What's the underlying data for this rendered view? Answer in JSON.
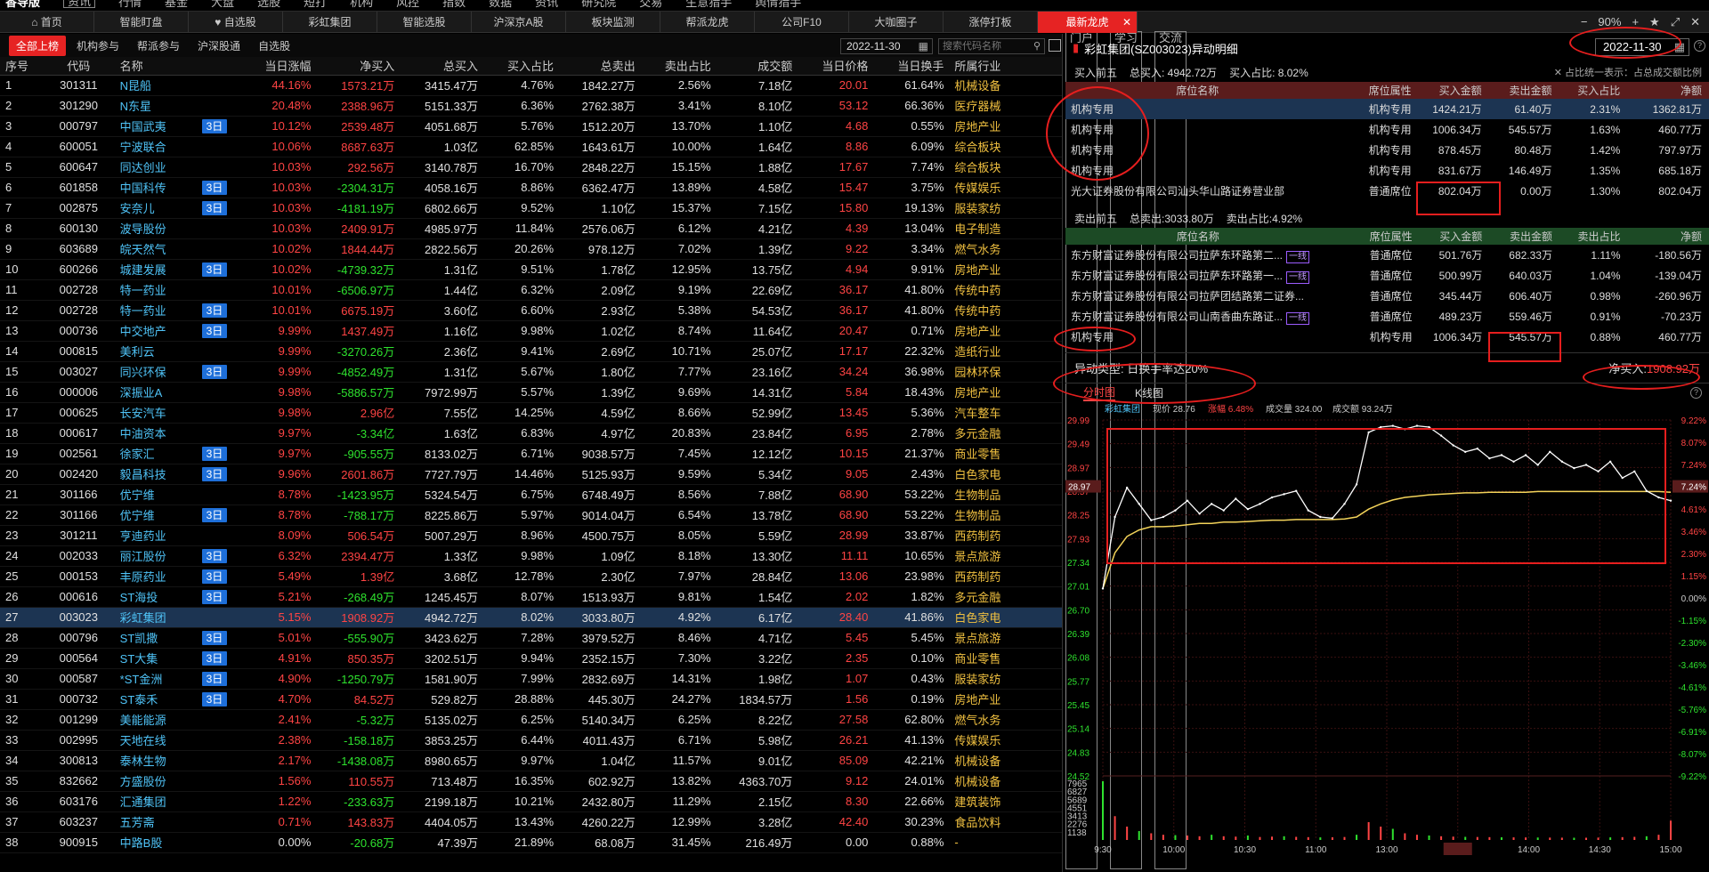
{
  "menubar": {
    "logo": "香导版",
    "logo_badge": "资讯",
    "items": [
      "行情",
      "基金",
      "大盘",
      "选股",
      "短打",
      "机构",
      "风控",
      "指数",
      "数据",
      "资讯",
      "研究院",
      "交易",
      "生意猎手",
      "舆情猎手"
    ],
    "right": [
      "门户",
      "学习",
      "交流"
    ]
  },
  "tabs": [
    "首页",
    "智能盯盘",
    "自选股",
    "彩虹集团",
    "智能选股",
    "沪深京A股",
    "板块监测",
    "帮派龙虎",
    "公司F10",
    "大咖圈子",
    "涨停打板",
    "最新龙虎"
  ],
  "zoom": "90%",
  "left": {
    "subtabs": [
      "全部上榜",
      "机构参与",
      "帮派参与",
      "沪深股通",
      "自选股"
    ],
    "date": "2022-11-30",
    "search_placeholder": "搜索代码名称",
    "columns": [
      "序号",
      "代码",
      "名称",
      "",
      "当日涨幅",
      "净买入",
      "总买入",
      "买入占比",
      "总卖出",
      "卖出占比",
      "成交额",
      "当日价格",
      "当日换手",
      "所属行业"
    ],
    "rows": [
      [
        "1",
        "301311",
        "N昆船",
        "",
        "44.16%",
        "1573.21万",
        "3415.47万",
        "4.76%",
        "1842.27万",
        "2.56%",
        "7.18亿",
        "20.01",
        "61.64%",
        "机械设备"
      ],
      [
        "2",
        "301290",
        "N东星",
        "",
        "20.48%",
        "2388.96万",
        "5151.33万",
        "6.36%",
        "2762.38万",
        "3.41%",
        "8.10亿",
        "53.12",
        "66.36%",
        "医疗器械"
      ],
      [
        "3",
        "000797",
        "中国武夷",
        "3日",
        "10.12%",
        "2539.48万",
        "4051.68万",
        "5.76%",
        "1512.20万",
        "13.70%",
        "1.10亿",
        "4.68",
        "0.55%",
        "房地产业"
      ],
      [
        "4",
        "600051",
        "宁波联合",
        "",
        "10.06%",
        "8687.63万",
        "1.03亿",
        "62.85%",
        "1643.61万",
        "10.00%",
        "1.64亿",
        "8.86",
        "6.09%",
        "综合板块"
      ],
      [
        "5",
        "600647",
        "同达创业",
        "",
        "10.03%",
        "292.56万",
        "3140.78万",
        "16.70%",
        "2848.22万",
        "15.15%",
        "1.88亿",
        "17.67",
        "7.74%",
        "综合板块"
      ],
      [
        "6",
        "601858",
        "中国科传",
        "3日",
        "10.03%",
        "-2304.31万",
        "4058.16万",
        "8.86%",
        "6362.47万",
        "13.89%",
        "4.58亿",
        "15.47",
        "3.75%",
        "传媒娱乐"
      ],
      [
        "7",
        "002875",
        "安奈儿",
        "3日",
        "10.03%",
        "-4181.19万",
        "6802.66万",
        "9.52%",
        "1.10亿",
        "15.37%",
        "7.15亿",
        "15.80",
        "19.13%",
        "服装家纺"
      ],
      [
        "8",
        "600130",
        "波导股份",
        "",
        "10.03%",
        "2409.91万",
        "4985.97万",
        "11.84%",
        "2576.06万",
        "6.12%",
        "4.21亿",
        "4.39",
        "13.04%",
        "电子制造"
      ],
      [
        "9",
        "603689",
        "皖天然气",
        "",
        "10.02%",
        "1844.44万",
        "2822.56万",
        "20.26%",
        "978.12万",
        "7.02%",
        "1.39亿",
        "9.22",
        "3.34%",
        "燃气水务"
      ],
      [
        "10",
        "600266",
        "城建发展",
        "3日",
        "10.02%",
        "-4739.32万",
        "1.31亿",
        "9.51%",
        "1.78亿",
        "12.95%",
        "13.75亿",
        "4.94",
        "9.91%",
        "房地产业"
      ],
      [
        "11",
        "002728",
        "特一药业",
        "",
        "10.01%",
        "-6506.97万",
        "1.44亿",
        "6.32%",
        "2.09亿",
        "9.19%",
        "22.69亿",
        "36.17",
        "41.80%",
        "传统中药"
      ],
      [
        "12",
        "002728",
        "特一药业",
        "3日",
        "10.01%",
        "6675.19万",
        "3.60亿",
        "6.60%",
        "2.93亿",
        "5.38%",
        "54.53亿",
        "36.17",
        "41.80%",
        "传统中药"
      ],
      [
        "13",
        "000736",
        "中交地产",
        "3日",
        "9.99%",
        "1437.49万",
        "1.16亿",
        "9.98%",
        "1.02亿",
        "8.74%",
        "11.64亿",
        "20.47",
        "0.71%",
        "房地产业"
      ],
      [
        "14",
        "000815",
        "美利云",
        "",
        "9.99%",
        "-3270.26万",
        "2.36亿",
        "9.41%",
        "2.69亿",
        "10.71%",
        "25.07亿",
        "17.17",
        "22.32%",
        "造纸行业"
      ],
      [
        "15",
        "003027",
        "同兴环保",
        "3日",
        "9.99%",
        "-4852.49万",
        "1.31亿",
        "5.67%",
        "1.80亿",
        "7.77%",
        "23.16亿",
        "34.24",
        "36.98%",
        "园林环保"
      ],
      [
        "16",
        "000006",
        "深振业A",
        "",
        "9.98%",
        "-5886.57万",
        "7972.99万",
        "5.57%",
        "1.39亿",
        "9.69%",
        "14.31亿",
        "5.84",
        "18.43%",
        "房地产业"
      ],
      [
        "17",
        "000625",
        "长安汽车",
        "",
        "9.98%",
        "2.96亿",
        "7.55亿",
        "14.25%",
        "4.59亿",
        "8.66%",
        "52.99亿",
        "13.45",
        "5.36%",
        "汽车整车"
      ],
      [
        "18",
        "000617",
        "中油资本",
        "",
        "9.97%",
        "-3.34亿",
        "1.63亿",
        "6.83%",
        "4.97亿",
        "20.83%",
        "23.84亿",
        "6.95",
        "2.78%",
        "多元金融"
      ],
      [
        "19",
        "002561",
        "徐家汇",
        "3日",
        "9.97%",
        "-905.55万",
        "8133.02万",
        "6.71%",
        "9038.57万",
        "7.45%",
        "12.12亿",
        "10.15",
        "21.37%",
        "商业零售"
      ],
      [
        "20",
        "002420",
        "毅昌科技",
        "3日",
        "9.96%",
        "2601.86万",
        "7727.79万",
        "14.46%",
        "5125.93万",
        "9.59%",
        "5.34亿",
        "9.05",
        "2.43%",
        "白色家电"
      ],
      [
        "21",
        "301166",
        "优宁维",
        "",
        "8.78%",
        "-1423.95万",
        "5324.54万",
        "6.75%",
        "6748.49万",
        "8.56%",
        "7.88亿",
        "68.90",
        "53.22%",
        "生物制品"
      ],
      [
        "22",
        "301166",
        "优宁维",
        "3日",
        "8.78%",
        "-788.17万",
        "8225.86万",
        "5.97%",
        "9014.04万",
        "6.54%",
        "13.78亿",
        "68.90",
        "53.22%",
        "生物制品"
      ],
      [
        "23",
        "301211",
        "亨迪药业",
        "",
        "8.09%",
        "506.54万",
        "5007.29万",
        "8.96%",
        "4500.75万",
        "8.05%",
        "5.59亿",
        "28.99",
        "33.87%",
        "西药制药"
      ],
      [
        "24",
        "002033",
        "丽江股份",
        "3日",
        "6.32%",
        "2394.47万",
        "1.33亿",
        "9.98%",
        "1.09亿",
        "8.18%",
        "13.30亿",
        "11.11",
        "10.65%",
        "景点旅游"
      ],
      [
        "25",
        "000153",
        "丰原药业",
        "3日",
        "5.49%",
        "1.39亿",
        "3.68亿",
        "12.78%",
        "2.30亿",
        "7.97%",
        "28.84亿",
        "13.06",
        "23.98%",
        "西药制药"
      ],
      [
        "26",
        "000616",
        "ST海投",
        "3日",
        "5.21%",
        "-268.49万",
        "1245.45万",
        "8.07%",
        "1513.93万",
        "9.81%",
        "1.54亿",
        "2.02",
        "1.82%",
        "多元金融"
      ],
      [
        "27",
        "003023",
        "彩虹集团",
        "",
        "5.15%",
        "1908.92万",
        "4942.72万",
        "8.02%",
        "3033.80万",
        "4.92%",
        "6.17亿",
        "28.40",
        "41.86%",
        "白色家电"
      ],
      [
        "28",
        "000796",
        "ST凯撒",
        "3日",
        "5.01%",
        "-555.90万",
        "3423.62万",
        "7.28%",
        "3979.52万",
        "8.46%",
        "4.71亿",
        "5.45",
        "5.45%",
        "景点旅游"
      ],
      [
        "29",
        "000564",
        "ST大集",
        "3日",
        "4.91%",
        "850.35万",
        "3202.51万",
        "9.94%",
        "2352.15万",
        "7.30%",
        "3.22亿",
        "2.35",
        "0.10%",
        "商业零售"
      ],
      [
        "30",
        "000587",
        "*ST金洲",
        "3日",
        "4.90%",
        "-1250.79万",
        "1581.90万",
        "7.99%",
        "2832.69万",
        "14.31%",
        "1.98亿",
        "1.07",
        "0.43%",
        "服装家纺"
      ],
      [
        "31",
        "000732",
        "ST泰禾",
        "3日",
        "4.70%",
        "84.52万",
        "529.82万",
        "28.88%",
        "445.30万",
        "24.27%",
        "1834.57万",
        "1.56",
        "0.19%",
        "房地产业"
      ],
      [
        "32",
        "001299",
        "美能能源",
        "",
        "2.41%",
        "-5.32万",
        "5135.02万",
        "6.25%",
        "5140.34万",
        "6.25%",
        "8.22亿",
        "27.58",
        "62.80%",
        "燃气水务"
      ],
      [
        "33",
        "002995",
        "天地在线",
        "",
        "2.38%",
        "-158.18万",
        "3853.25万",
        "6.44%",
        "4011.43万",
        "6.71%",
        "5.98亿",
        "26.21",
        "41.13%",
        "传媒娱乐"
      ],
      [
        "34",
        "300813",
        "泰林生物",
        "",
        "2.17%",
        "-1438.08万",
        "8980.65万",
        "9.97%",
        "1.04亿",
        "11.57%",
        "9.01亿",
        "85.09",
        "42.21%",
        "机械设备"
      ],
      [
        "35",
        "832662",
        "方盛股份",
        "",
        "1.56%",
        "110.55万",
        "713.48万",
        "16.35%",
        "602.92万",
        "13.82%",
        "4363.70万",
        "9.12",
        "24.01%",
        "机械设备"
      ],
      [
        "36",
        "603176",
        "汇通集团",
        "",
        "1.22%",
        "-233.63万",
        "2199.18万",
        "10.21%",
        "2432.80万",
        "11.29%",
        "2.15亿",
        "8.30",
        "22.66%",
        "建筑装饰"
      ],
      [
        "37",
        "603237",
        "五芳斋",
        "",
        "0.71%",
        "143.83万",
        "4404.05万",
        "13.43%",
        "4260.22万",
        "12.99%",
        "3.28亿",
        "42.40",
        "30.23%",
        "食品饮料"
      ],
      [
        "38",
        "900915",
        "中路B股",
        "",
        "0.00%",
        "-20.68万",
        "47.39万",
        "21.89%",
        "68.08万",
        "31.45%",
        "216.49万",
        "0.00",
        "0.88%",
        "-"
      ]
    ]
  },
  "right": {
    "title": "彩虹集团(SZ003023)异动明细",
    "date": "2022-11-30",
    "buy_summary": {
      "label": "买入前五",
      "total": "总买入: 4942.72万",
      "ratio": "买入占比: 8.02%",
      "note": "占比统一表示：占总成交额比例"
    },
    "buy_columns": [
      "席位名称",
      "席位属性",
      "买入金额",
      "卖出金额",
      "买入占比",
      "净额"
    ],
    "buy_rows": [
      [
        "机构专用",
        "",
        "机构专用",
        "1424.21万",
        "61.40万",
        "2.31%",
        "1362.81万"
      ],
      [
        "机构专用",
        "",
        "机构专用",
        "1006.34万",
        "545.57万",
        "1.63%",
        "460.77万"
      ],
      [
        "机构专用",
        "",
        "机构专用",
        "878.45万",
        "80.48万",
        "1.42%",
        "797.97万"
      ],
      [
        "机构专用",
        "",
        "机构专用",
        "831.67万",
        "146.49万",
        "1.35%",
        "685.18万"
      ],
      [
        "光大证券股份有限公司汕头华山路证券营业部",
        "",
        "普通席位",
        "802.04万",
        "0.00万",
        "1.30%",
        "802.04万"
      ]
    ],
    "sell_summary": {
      "label": "卖出前五",
      "total": "总卖出:3033.80万",
      "ratio": "卖出占比:4.92%"
    },
    "sell_columns": [
      "席位名称",
      "席位属性",
      "买入金额",
      "卖出金额",
      "卖出占比",
      "净额"
    ],
    "sell_rows": [
      [
        "东方财富证券股份有限公司拉萨东环路第二...",
        "一线",
        "普通席位",
        "501.76万",
        "682.33万",
        "1.11%",
        "-180.56万"
      ],
      [
        "东方财富证券股份有限公司拉萨东环路第一...",
        "一线",
        "普通席位",
        "500.99万",
        "640.03万",
        "1.04%",
        "-139.04万"
      ],
      [
        "东方财富证券股份有限公司拉萨团结路第二证券...",
        "",
        "普通席位",
        "345.44万",
        "606.40万",
        "0.98%",
        "-260.96万"
      ],
      [
        "东方财富证券股份有限公司山南香曲东路证...",
        "一线",
        "普通席位",
        "489.23万",
        "559.46万",
        "0.91%",
        "-70.23万"
      ],
      [
        "机构专用",
        "",
        "机构专用",
        "1006.34万",
        "545.57万",
        "0.88%",
        "460.77万"
      ]
    ],
    "type_label": "异动类型: 日换手率达20%",
    "net_label": "净买入:",
    "net_value": "1908.92万",
    "chart_tabs": [
      "分时图",
      "K线图"
    ],
    "chart_info": [
      "彩虹集团",
      "现价 28.76",
      "涨幅 6.48%",
      "成交量 324.00",
      "成交额 93.24万"
    ]
  },
  "chart_data": {
    "type": "line",
    "x_ticks": [
      "9:30",
      "10:00",
      "10:30",
      "11:00",
      "13:00",
      "13:21",
      "14:00",
      "14:30",
      "15:00"
    ],
    "y_left_ticks": [
      "29.99",
      "29.49",
      "28.97",
      "28.57",
      "28.25",
      "27.93",
      "27.34",
      "27.01",
      "26.70",
      "26.39",
      "26.08",
      "25.77",
      "25.45",
      "25.14",
      "24.83",
      "24.52"
    ],
    "y_right_ticks": [
      "9.22%",
      "8.07%",
      "7.24%",
      "5.76%",
      "4.61%",
      "3.46%",
      "2.30%",
      "1.15%",
      "0.00%",
      "-1.15%",
      "-2.30%",
      "-3.46%",
      "-4.61%",
      "-5.76%",
      "-6.91%",
      "-8.07%",
      "-9.22%"
    ],
    "vol_ticks": [
      "7965",
      "6827",
      "5689",
      "4551",
      "3413",
      "2276",
      "1138"
    ],
    "current_price_label": "28.97",
    "current_pct_label": "7.24%",
    "ylim": [
      24.52,
      29.99
    ],
    "price": [
      27.4,
      28.5,
      28.95,
      28.7,
      28.45,
      28.5,
      28.6,
      28.75,
      28.55,
      28.7,
      28.6,
      28.78,
      28.62,
      28.7,
      28.8,
      28.85,
      28.9,
      28.6,
      28.5,
      28.48,
      28.7,
      29.0,
      29.8,
      29.88,
      29.9,
      29.85,
      29.9,
      29.88,
      29.75,
      29.6,
      29.5,
      29.55,
      29.4,
      29.45,
      29.35,
      29.45,
      29.3,
      29.5,
      29.35,
      29.25,
      29.3,
      29.2,
      29.35,
      29.1,
      29.2,
      28.9,
      28.8,
      28.75
    ],
    "avg": [
      27.4,
      27.95,
      28.2,
      28.3,
      28.35,
      28.35,
      28.36,
      28.38,
      28.4,
      28.4,
      28.42,
      28.42,
      28.43,
      28.44,
      28.45,
      28.45,
      28.46,
      28.46,
      28.46,
      28.46,
      28.47,
      28.5,
      28.62,
      28.7,
      28.76,
      28.8,
      28.82,
      28.84,
      28.85,
      28.86,
      28.87,
      28.87,
      28.88,
      28.88,
      28.88,
      28.88,
      28.89,
      28.89,
      28.89,
      28.89,
      28.89,
      28.89,
      28.89,
      28.89,
      28.89,
      28.89,
      28.89,
      28.88
    ],
    "volume": [
      7900,
      3200,
      1800,
      1200,
      900,
      700,
      650,
      600,
      500,
      700,
      500,
      450,
      600,
      400,
      450,
      500,
      420,
      380,
      350,
      360,
      400,
      700,
      2400,
      1800,
      1500,
      900,
      700,
      600,
      500,
      450,
      420,
      400,
      380,
      360,
      350,
      340,
      330,
      320,
      310,
      300,
      300,
      320,
      350,
      380,
      420,
      500,
      700,
      2600
    ]
  }
}
